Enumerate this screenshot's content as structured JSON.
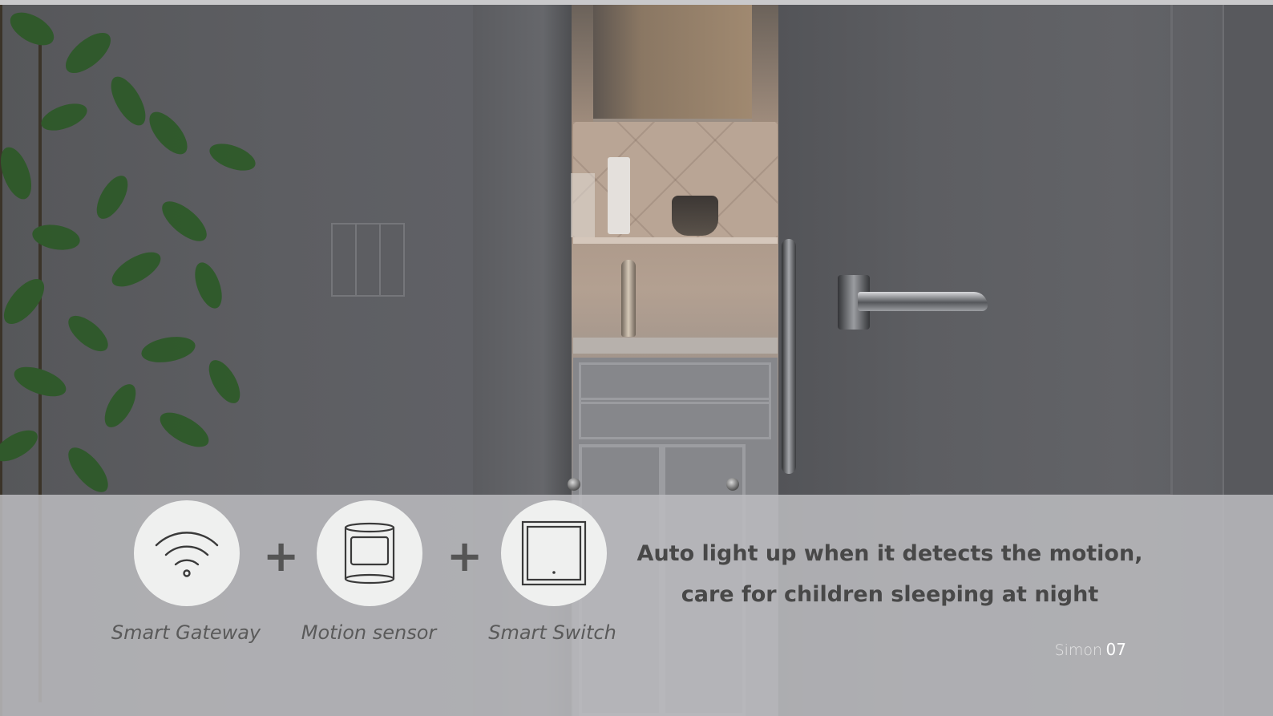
{
  "devices": [
    {
      "label": "Smart Gateway",
      "icon": "wifi-icon"
    },
    {
      "label": "Motion sensor",
      "icon": "motion-sensor-icon"
    },
    {
      "label": "Smart Switch",
      "icon": "switch-icon"
    }
  ],
  "plus_sign": "+",
  "headline": {
    "line1": "Auto light up when it detects the motion,",
    "line2": "care for children sleeping at night"
  },
  "brand": {
    "name": "Simon",
    "page_number": "07"
  },
  "colors": {
    "panel": "#bbbcbf",
    "device_circle": "#eff0ef",
    "headline_text": "#484848",
    "label_text": "#5a5a5a",
    "wall": "#5d5e62"
  }
}
